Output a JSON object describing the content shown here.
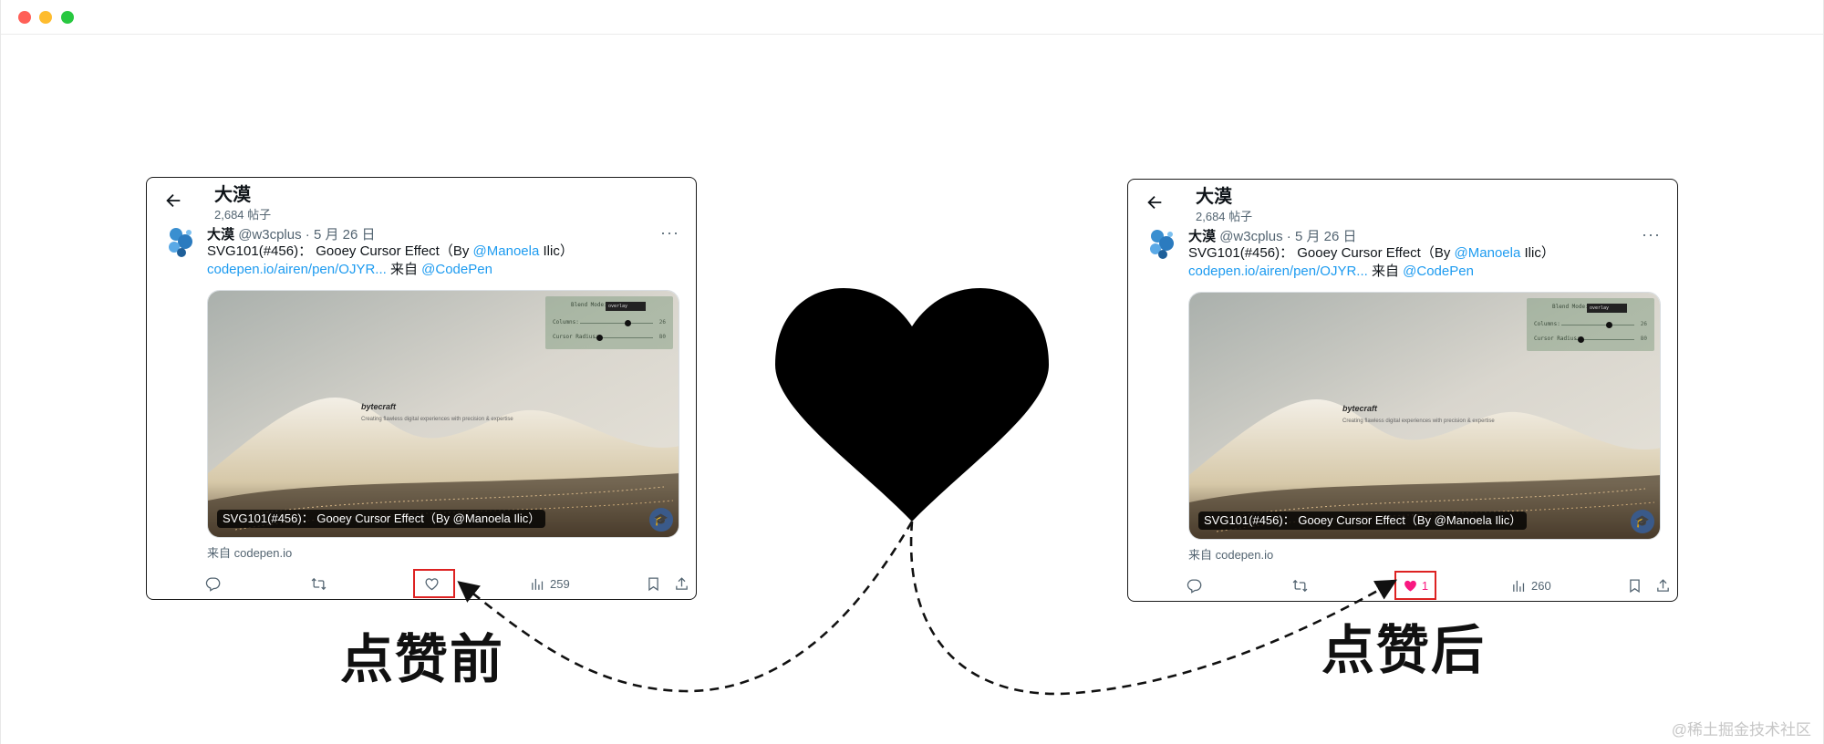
{
  "colors": {
    "accent_link": "#1d9bf0",
    "like_pink": "#f91880",
    "highlight_box": "#dd2222"
  },
  "cards": [
    {
      "id": "before",
      "header": {
        "author_title": "大漠",
        "post_count": "2,684 帖子"
      },
      "tweet": {
        "name": "大漠",
        "handle": "@w3cplus",
        "date": " · 5 月 26 日",
        "text_line1_prefix": "SVG101(#456)：  Gooey Cursor Effect（By ",
        "text_mention": "@Manoela",
        "text_line1_suffix": " Ilic）",
        "link": "codepen.io/airen/pen/OJYR...",
        "from_label": " 来自 ",
        "codepen_mention": "@CodePen"
      },
      "media": {
        "panel_blend_label": "Blend Mode:",
        "panel_blend_value": "overlay",
        "panel_columns_label": "Columns:",
        "panel_columns_value": "26",
        "panel_cursor_label": "Cursor Radius:",
        "panel_cursor_value": "80",
        "columns_fraction": 0.65,
        "cursor_fraction": 0.08,
        "brand": "bytecraft",
        "tagline": "Creating flawless digital experiences with precision & expertise",
        "caption": "SVG101(#456)：  Gooey Cursor Effect（By @Manoela Ilic）"
      },
      "source": "来自 codepen.io",
      "actions": {
        "like_count": "",
        "views_count": "259",
        "liked": false
      }
    },
    {
      "id": "after",
      "header": {
        "author_title": "大漠",
        "post_count": "2,684 帖子"
      },
      "tweet": {
        "name": "大漠",
        "handle": "@w3cplus",
        "date": " · 5 月 26 日",
        "text_line1_prefix": "SVG101(#456)：  Gooey Cursor Effect（By ",
        "text_mention": "@Manoela",
        "text_line1_suffix": " Ilic）",
        "link": "codepen.io/airen/pen/OJYR...",
        "from_label": " 来自 ",
        "codepen_mention": "@CodePen"
      },
      "media": {
        "panel_blend_label": "Blend Mode:",
        "panel_blend_value": "overlay",
        "panel_columns_label": "Columns:",
        "panel_columns_value": "26",
        "panel_cursor_label": "Cursor Radius:",
        "panel_cursor_value": "80",
        "columns_fraction": 0.65,
        "cursor_fraction": 0.08,
        "brand": "bytecraft",
        "tagline": "Creating flawless digital experiences with precision & expertise",
        "caption": "SVG101(#456)：  Gooey Cursor Effect（By @Manoela Ilic）"
      },
      "source": "来自 codepen.io",
      "actions": {
        "like_count": "1",
        "views_count": "260",
        "liked": true
      }
    }
  ],
  "labels": {
    "before": "点赞前",
    "after": "点赞后"
  },
  "watermark": "@稀土掘金技术社区"
}
